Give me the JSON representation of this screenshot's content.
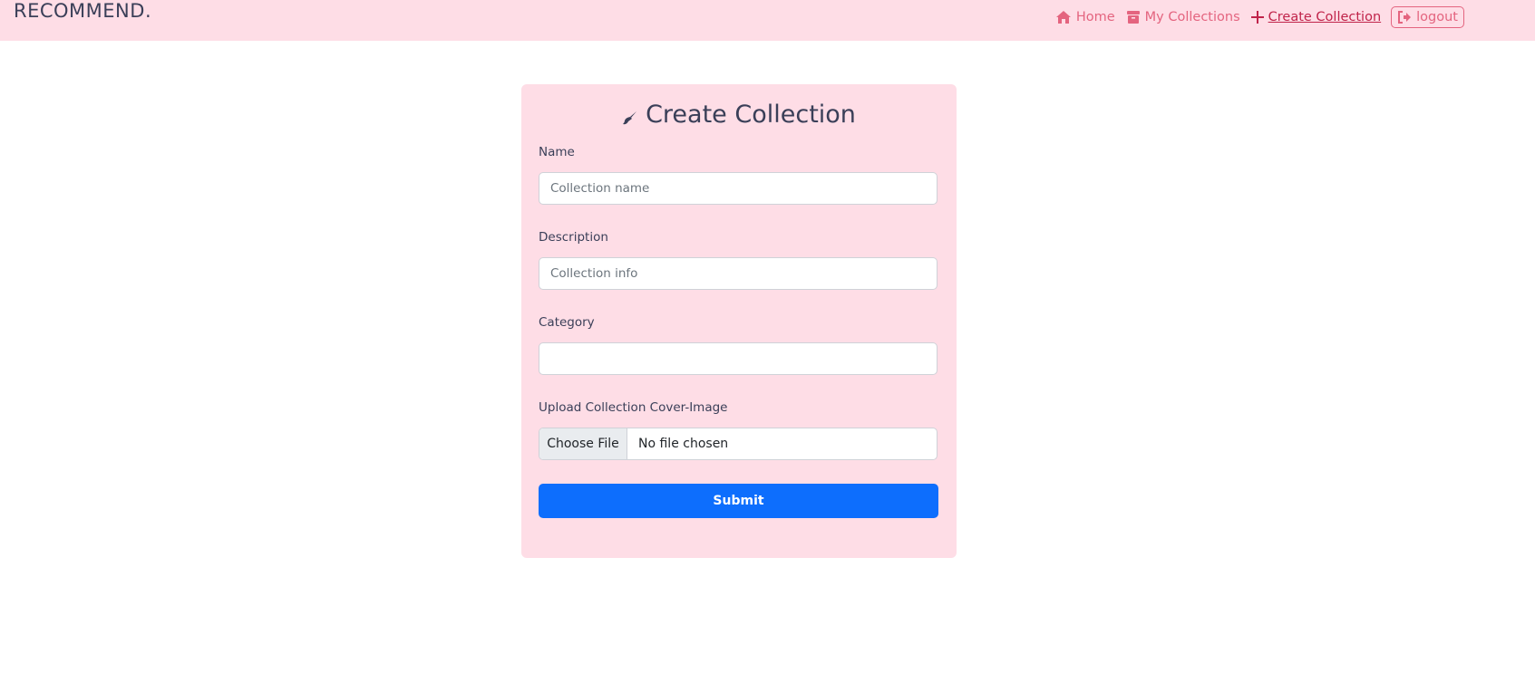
{
  "navbar": {
    "brand": "RECOMMEND.",
    "links": [
      {
        "label": "Home",
        "icon": "home-icon"
      },
      {
        "label": "My Collections",
        "icon": "archive-icon"
      },
      {
        "label": "Create Collection",
        "icon": "plus-icon",
        "active": true
      },
      {
        "label": "logout",
        "icon": "logout-icon"
      }
    ]
  },
  "form": {
    "title": "Create Collection",
    "title_icon": "brush-icon",
    "name": {
      "label": "Name",
      "placeholder": "Collection name",
      "value": ""
    },
    "description": {
      "label": "Description",
      "placeholder": "Collection info",
      "value": ""
    },
    "category": {
      "label": "Category",
      "value": ""
    },
    "upload": {
      "label": "Upload Collection Cover-Image",
      "button": "Choose File",
      "status": "No file chosen"
    },
    "submit_label": "Submit"
  },
  "colors": {
    "navbar_bg": "#fedde6",
    "card_bg": "#fedde6",
    "link": "#e4647f",
    "primary": "#0d6efd",
    "text": "#3a3f58"
  }
}
